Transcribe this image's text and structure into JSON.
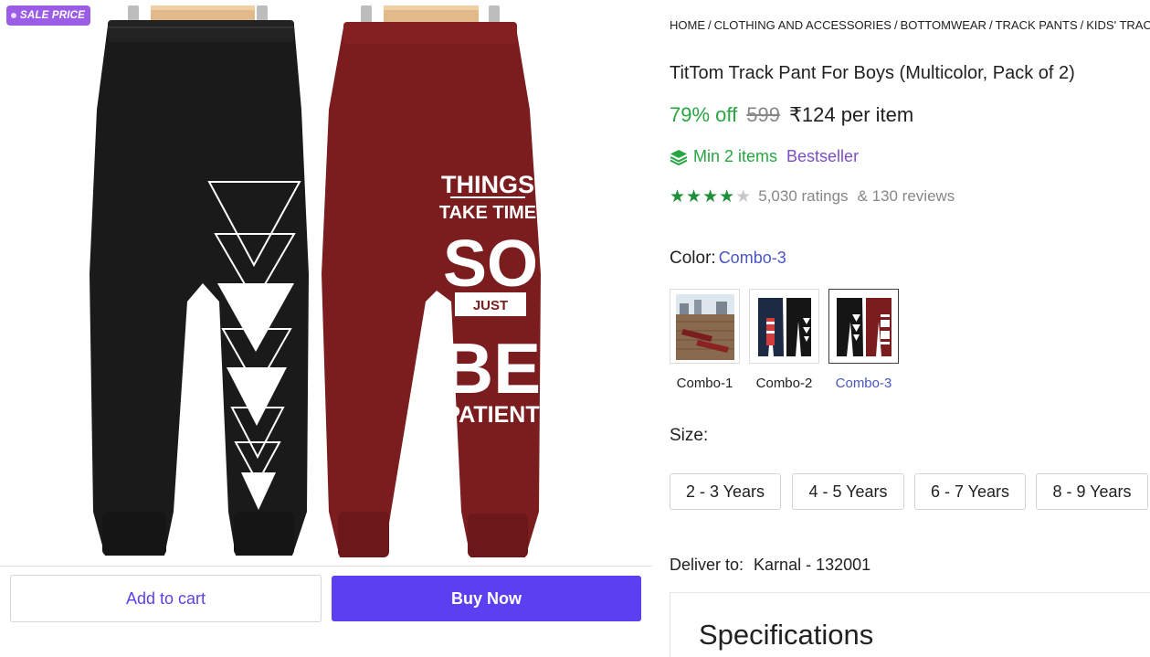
{
  "image_pane": {
    "sale_badge": "SALE PRICE",
    "print_text": [
      "THINGS",
      "TAKE TIME",
      "SO",
      "JUST",
      "BE",
      "PATIENT"
    ],
    "pants_colors": [
      "#1a1a1a",
      "#7b1c1e"
    ]
  },
  "actions": {
    "add_to_cart": "Add to cart",
    "buy_now": "Buy Now"
  },
  "breadcrumb": [
    "HOME",
    "CLOTHING AND ACCESSORIES",
    "BOTTOMWEAR",
    "TRACK PANTS",
    "KIDS' TRACK"
  ],
  "breadcrumb_separator": "/",
  "product": {
    "title": "TitTom Track Pant For Boys (Multicolor, Pack of 2)",
    "discount": "79% off",
    "mrp": "599",
    "price": "₹124 per item",
    "min_items": "Min 2 items",
    "bestseller": "Bestseller",
    "rating_stars": 4,
    "ratings": "5,030 ratings",
    "reviews": "& 130 reviews"
  },
  "color": {
    "label": "Color:",
    "selected": "Combo-3",
    "options": [
      "Combo-1",
      "Combo-2",
      "Combo-3"
    ]
  },
  "size": {
    "label": "Size:",
    "options": [
      "2 - 3 Years",
      "4 - 5 Years",
      "6 - 7 Years",
      "8 - 9 Years"
    ]
  },
  "delivery": {
    "label": "Deliver to:",
    "value": "Karnal - 132001"
  },
  "specifications": {
    "title": "Specifications"
  },
  "colors": {
    "accent": "#5b3ff0",
    "green": "#26a541",
    "bestseller": "#7b4fc6",
    "link": "#4a55c2",
    "badge": "#9b5de5"
  }
}
